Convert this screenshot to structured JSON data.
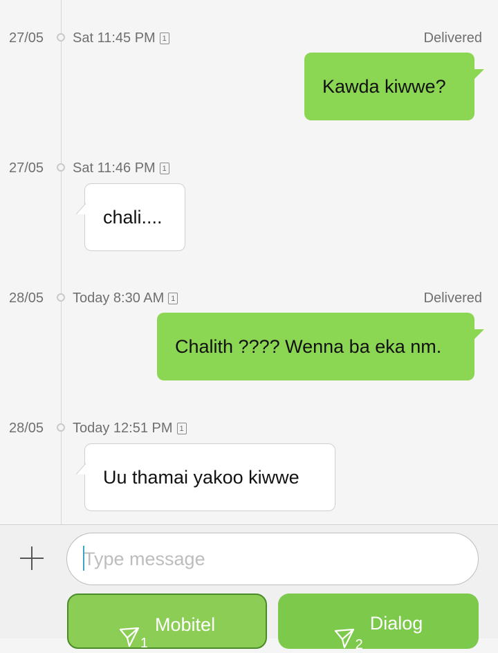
{
  "messages": [
    {
      "date": "27/05",
      "time": "Sat 11:45 PM",
      "sim": "1",
      "status": "Delivered",
      "direction": "out",
      "text": "Kawda kiwwe?"
    },
    {
      "date": "27/05",
      "time": "Sat 11:46 PM",
      "sim": "1",
      "status": "",
      "direction": "in",
      "text": "chali...."
    },
    {
      "date": "28/05",
      "time": "Today 8:30 AM",
      "sim": "1",
      "status": "Delivered",
      "direction": "out",
      "text": "Chalith ???? Wenna ba eka nm."
    },
    {
      "date": "28/05",
      "time": "Today 12:51 PM",
      "sim": "1",
      "status": "",
      "direction": "in",
      "text": "Uu thamai yakoo kiwwe"
    }
  ],
  "composer": {
    "placeholder": "Type message",
    "add_icon": "plus-icon",
    "send_buttons": [
      {
        "sim": "1",
        "label": "Mobitel",
        "icon": "send-icon"
      },
      {
        "sim": "2",
        "label": "Dialog",
        "icon": "send-icon"
      }
    ]
  },
  "colors": {
    "outgoing_bubble": "#8bd653",
    "incoming_bubble": "#ffffff",
    "background": "#f5f5f5",
    "input_caret": "#3aa6c7"
  }
}
